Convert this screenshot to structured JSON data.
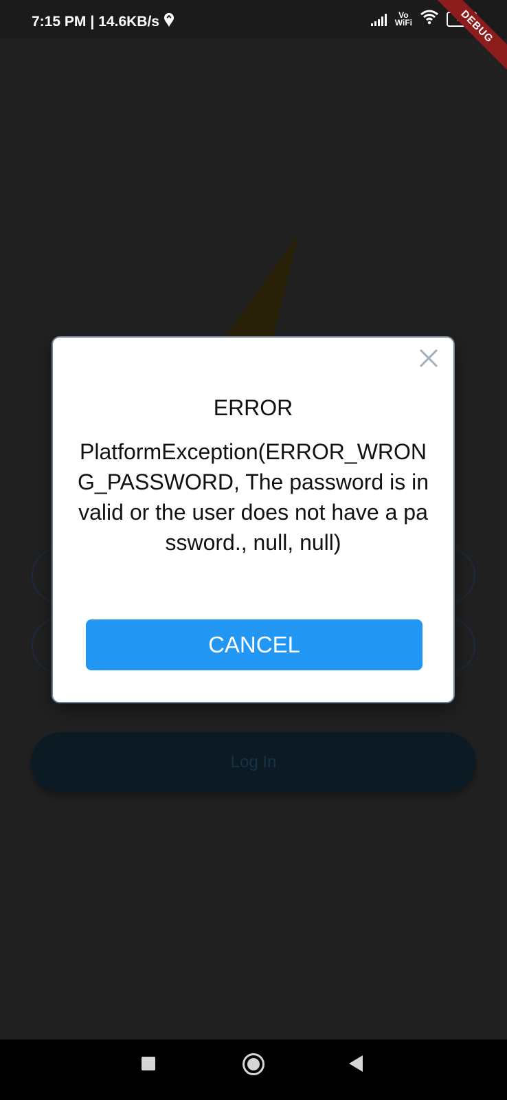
{
  "status_bar": {
    "time": "7:15 PM",
    "speed": "14.6KB/s",
    "vowifi_top": "Vo",
    "vowifi_bottom": "WiFi",
    "battery": "41",
    "icons": [
      "app-drop-icon",
      "signal-icon",
      "wifi-icon",
      "battery-icon"
    ]
  },
  "debug_banner": "DEBUG",
  "background": {
    "login_button_label": "Log In"
  },
  "dialog": {
    "title": "ERROR",
    "message": "PlatformException(ERROR_WRONG_PASSWORD, The password is invalid or the user does not have a password., null, null)",
    "cancel_label": "CANCEL",
    "close_icon": "close-icon"
  },
  "colors": {
    "primary": "#2196f3",
    "background": "#212121",
    "debug_banner": "#8d1c1c"
  },
  "nav_bar": {
    "icons": [
      "recents-icon",
      "home-icon",
      "back-icon"
    ]
  }
}
